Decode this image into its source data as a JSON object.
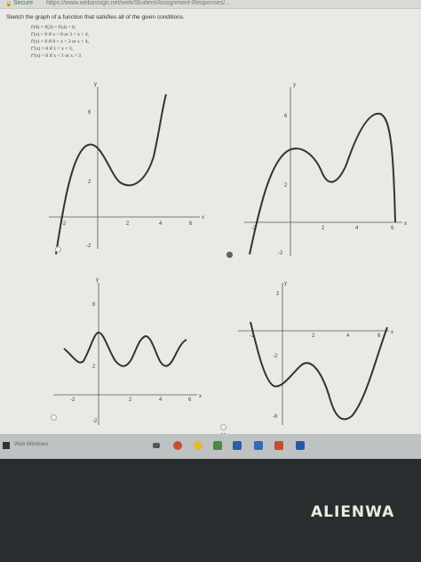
{
  "browser": {
    "secure_label": "Secure",
    "url": "https://www.webassign.net/web/Student/Assignment-Responses/..."
  },
  "problem": {
    "prompt": "Sketch the graph of a function that satisfies all of the given conditions.",
    "conditions": [
      "f'(0) = f'(2) = f'(4) = 0,",
      "f'(x) > 0 if x < 0 or 2 < x < 4,",
      "f'(x) < 0 if 0 < x < 2 or x > 4,",
      "f''(x) > 0 if 1 < x < 3,",
      "f''(x) < 0 if x < 1 or x > 3"
    ]
  },
  "graphs": [
    {
      "x_label": "x",
      "y_label": "y",
      "ticks": [
        "6",
        "2",
        "-2",
        "2",
        "4",
        "6",
        "-2"
      ],
      "selected": false
    },
    {
      "x_label": "x",
      "y_label": "y",
      "ticks": [
        "6",
        "2",
        "-2",
        "2",
        "4",
        "6",
        "-2"
      ],
      "selected": true
    },
    {
      "x_label": "x",
      "y_label": "y",
      "ticks": [
        "6",
        "2",
        "-2",
        "2",
        "4",
        "6",
        "-2"
      ],
      "selected": false
    },
    {
      "x_label": "x",
      "y_label": "y",
      "ticks": [
        "2",
        "-2",
        "-6",
        "-2",
        "2",
        "4",
        "6"
      ],
      "selected": false
    }
  ],
  "taskbar": {
    "search_placeholder": "Web Windows"
  },
  "laptop": {
    "brand": "ALIENWA"
  },
  "colors": {
    "screen_bg": "#e9e9e6",
    "curve": "#333333",
    "bezel": "#2a2d2f"
  }
}
